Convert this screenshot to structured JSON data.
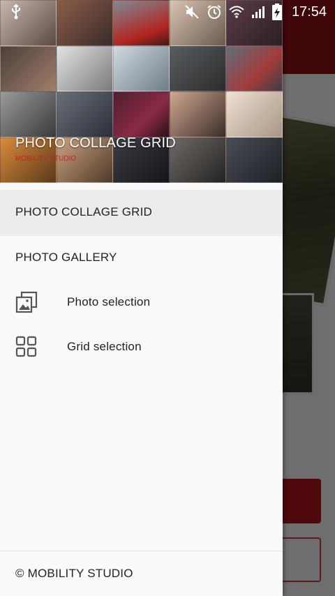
{
  "status_bar": {
    "time": "17:54",
    "icons": [
      "usb-icon",
      "mute-icon",
      "alarm-icon",
      "wifi-icon",
      "signal-icon",
      "battery-charging-icon"
    ]
  },
  "drawer": {
    "header": {
      "title": "PHOTO COLLAGE GRID",
      "subtitle": "MOBILITY STUDIO"
    },
    "items": [
      {
        "label": "PHOTO COLLAGE GRID",
        "selected": true
      },
      {
        "label": "PHOTO GALLERY",
        "selected": false
      }
    ],
    "sub_items": [
      {
        "label": "Photo selection",
        "icon": "photo-stack-icon"
      },
      {
        "label": "Grid selection",
        "icon": "grid-icon"
      }
    ],
    "footer": "© MOBILITY STUDIO"
  },
  "colors": {
    "accent": "#8e1014",
    "scrim": "rgba(0,0,0,0.55)",
    "selected_bg": "#ececec"
  }
}
